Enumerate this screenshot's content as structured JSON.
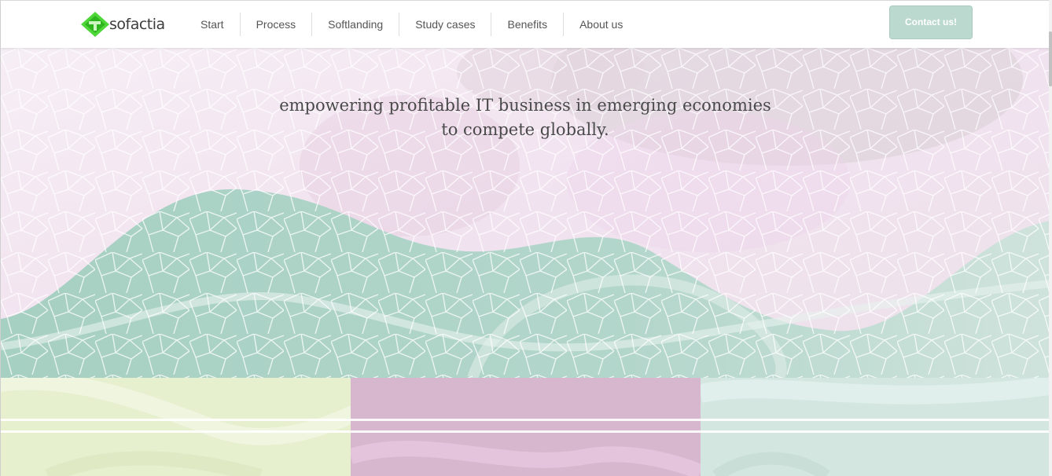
{
  "header": {
    "logo_text": "sofactia",
    "logo_icon": "sofactia-logo-icon",
    "nav": [
      "Start",
      "Process",
      "Softlanding",
      "Study cases",
      "Benefits",
      "About us"
    ],
    "contact_label": "Contact us!"
  },
  "hero": {
    "tagline_line1": "empowering profitable IT business in emerging economies",
    "tagline_line2": "to compete globally."
  },
  "colors": {
    "hero_pink": "#f3e7f1",
    "wave_green": "#9dcbbb",
    "panel_left": "#e6efce",
    "panel_middle": "#dcb7d4",
    "panel_right": "#d3e6e0",
    "button": "#bcd9cf"
  }
}
